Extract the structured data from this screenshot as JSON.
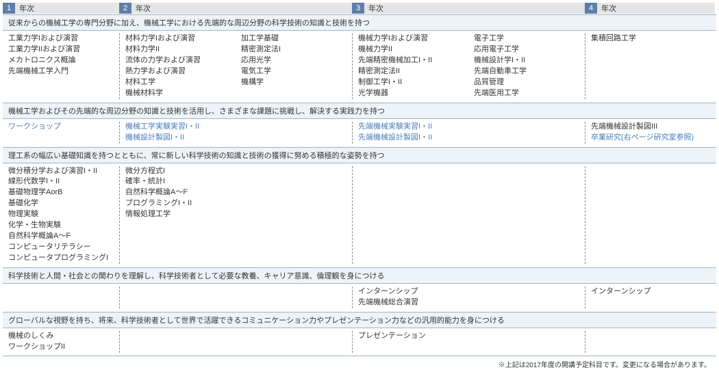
{
  "years": [
    {
      "num": "1",
      "label": "年次"
    },
    {
      "num": "2",
      "label": "年次"
    },
    {
      "num": "3",
      "label": "年次"
    },
    {
      "num": "4",
      "label": "年次"
    }
  ],
  "sections": [
    {
      "head": "従来からの機械工学の専門分野に加え、機械工学における先端的な周辺分野の科学技術の知識と技術を持つ",
      "cols": {
        "c1": [
          "工業力学Iおよび演習",
          "工業力学IIおよび演習",
          "メカトロニクス概論",
          "先端機械工学入門"
        ],
        "c2a": [
          "材料力学Iおよび演習",
          "材料力学II",
          "流体の力学および演習",
          "熱力学および演習",
          "材料工学",
          "機械材料学"
        ],
        "c2b": [
          "加工学基礎",
          "精密測定法I",
          "応用光学",
          "電気工学",
          "機構学"
        ],
        "c3a": [
          "機械力学Iおよび演習",
          "機械力学II",
          "先端精密機械加工I・II",
          "精密測定法II",
          "制御工学I・II",
          "光学機器"
        ],
        "c3b": [
          "電子工学",
          "応用電子工学",
          "機械設計学I・II",
          "先端自動車工学",
          "品質管理",
          "先端医用工学"
        ],
        "c4": [
          "集積回路工学"
        ]
      }
    },
    {
      "head": "機械工学およびその先端的な周辺分野の知識と技術を活用し、さまざまな課題に挑戦し、解決する実践力を持つ",
      "cols": {
        "c1": [
          {
            "t": "ワークショップ",
            "link": true
          }
        ],
        "c2a": [
          {
            "t": "機械工学実験実習I・II",
            "link": true
          },
          {
            "t": "機械設計製図I・II",
            "link": true
          }
        ],
        "c2b": [],
        "c3a": [
          {
            "t": "先端機械実験実習I・II",
            "link": true
          },
          {
            "t": "先端機械設計製図I・II",
            "link": true
          }
        ],
        "c3b": [],
        "c4": [
          {
            "t": "先端機械設計製図III"
          },
          {
            "t": "卒業研究(右ページ研究室参照)",
            "link": true
          }
        ]
      }
    },
    {
      "head": "理工系の幅広い基礎知識を持つとともに、常に新しい科学技術の知識と技術の獲得に努める積極的な姿勢を持つ",
      "cols": {
        "c1": [
          "微分積分学および演習I・II",
          "線形代数学I・II",
          "基礎物理学AorB",
          "基礎化学",
          "物理実験",
          "化学・生物実験",
          "自然科学概論A～F",
          "コンピュータリテラシー",
          "コンピュータプログラミングI"
        ],
        "c2a": [
          "微分方程式I",
          "確率・統計I",
          "自然科学概論A～F",
          "プログラミングI・II",
          "情報処理工学"
        ],
        "c2b": [],
        "c3a": [],
        "c3b": [],
        "c4": []
      }
    },
    {
      "head": "科学技術と人間・社会との関わりを理解し、科学技術者として必要な教養、キャリア意識、倫理観を身につける",
      "cols": {
        "c1": [],
        "c2a": [],
        "c2b": [],
        "c3a": [
          "インターンシップ",
          "先端機械総合演習"
        ],
        "c3b": [],
        "c4": [
          "インターンシップ"
        ]
      }
    },
    {
      "head": "グローバルな視野を持ち、将来、科学技術者として世界で活躍できるコミュニケーション力やプレゼンテーション力などの汎用的能力を身につける",
      "cols": {
        "c1": [
          "機械のしくみ",
          "ワークショップII"
        ],
        "c2a": [],
        "c2b": [],
        "c3a": [
          "プレゼンテーション"
        ],
        "c3b": [],
        "c4": []
      }
    }
  ],
  "footnote": "※上記は2017年度の開講予定科目です。変更になる場合があります。"
}
